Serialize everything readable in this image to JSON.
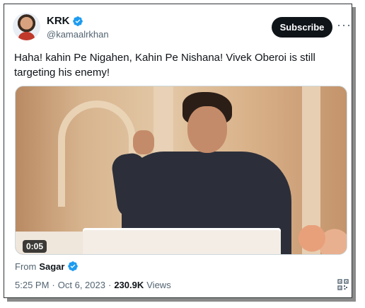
{
  "author": {
    "display_name": "KRK",
    "handle": "@kamaalrkhan"
  },
  "header": {
    "subscribe_label": "Subscribe",
    "more_label": "···"
  },
  "tweet": {
    "text": "Haha! kahin Pe Nigahen, Kahin Pe Nishana! Vivek Oberoi is still targeting his enemy!"
  },
  "media": {
    "duration": "0:05"
  },
  "source": {
    "prefix": "From",
    "name": "Sagar"
  },
  "meta": {
    "time": "5:25 PM",
    "sep1": "·",
    "date": "Oct 6, 2023",
    "sep2": "·",
    "views_count": "230.9K",
    "views_label": "Views"
  },
  "colors": {
    "verified_blue": "#1d9bf0",
    "text_primary": "#0f1419",
    "text_secondary": "#536471"
  }
}
